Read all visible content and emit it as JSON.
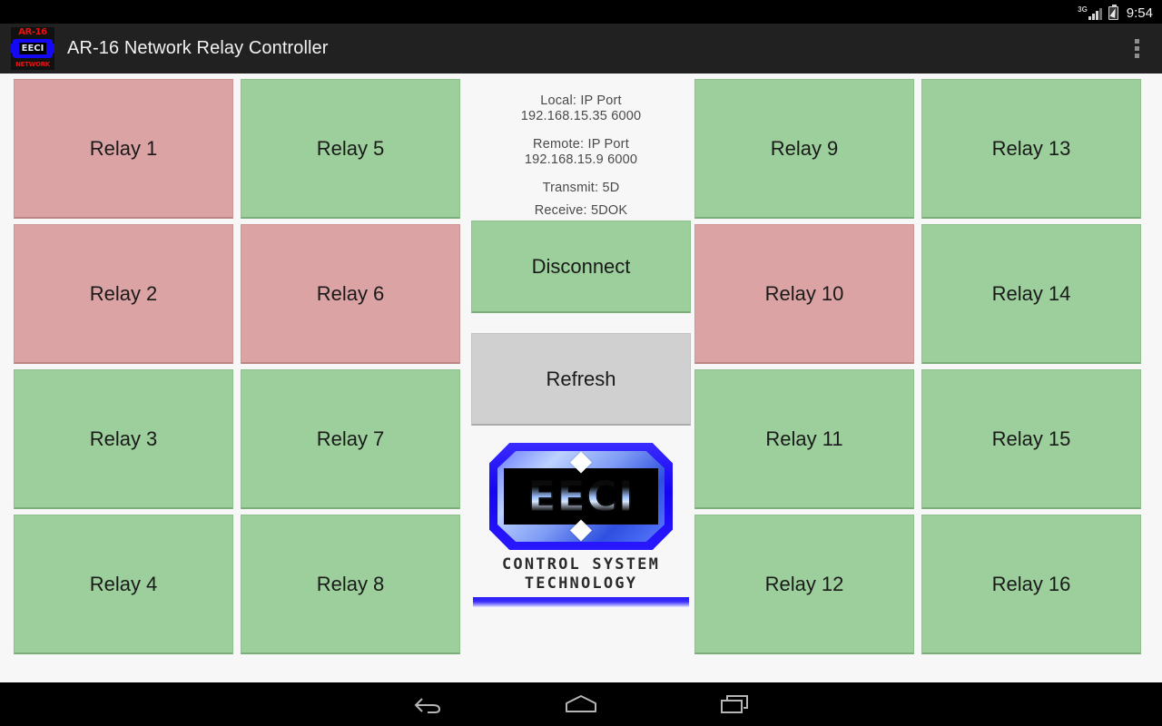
{
  "status_bar": {
    "network_label": "3G",
    "clock": "9:54",
    "battery_state": "charging"
  },
  "action_bar": {
    "app_title": "AR-16 Network Relay Controller",
    "app_icon": {
      "top_text": "AR-16",
      "badge_text": "EECI",
      "bottom_text": "NETWORK"
    },
    "overflow_label": "More options"
  },
  "connection_info": {
    "local": {
      "header": "Local:  IP   Port",
      "value": "192.168.15.35   6000",
      "ip": "192.168.15.35",
      "port": "6000"
    },
    "remote": {
      "header": "Remote:  IP   Port",
      "value": "192.168.15.9   6000",
      "ip": "192.168.15.9",
      "port": "6000"
    },
    "transmit": "Transmit:  5D",
    "receive": "Receive:  5DOK"
  },
  "actions": {
    "disconnect_label": "Disconnect",
    "refresh_label": "Refresh"
  },
  "logo": {
    "badge_text": "EECI",
    "line1": "CONTROL SYSTEM",
    "line2": "TECHNOLOGY"
  },
  "colors": {
    "relay_on": "#dba3a3",
    "relay_off": "#9ccf9b",
    "refresh": "#d0d0d0",
    "action_bar": "#212121",
    "background": "#f7f7f7"
  },
  "relays": {
    "columns": [
      [
        {
          "label": "Relay 1",
          "state": "on"
        },
        {
          "label": "Relay 2",
          "state": "on"
        },
        {
          "label": "Relay 3",
          "state": "off"
        },
        {
          "label": "Relay 4",
          "state": "off"
        }
      ],
      [
        {
          "label": "Relay 5",
          "state": "off"
        },
        {
          "label": "Relay 6",
          "state": "on"
        },
        {
          "label": "Relay 7",
          "state": "off"
        },
        {
          "label": "Relay 8",
          "state": "off"
        }
      ],
      [
        {
          "label": "Relay 9",
          "state": "off"
        },
        {
          "label": "Relay 10",
          "state": "on"
        },
        {
          "label": "Relay 11",
          "state": "off"
        },
        {
          "label": "Relay 12",
          "state": "off"
        }
      ],
      [
        {
          "label": "Relay 13",
          "state": "off"
        },
        {
          "label": "Relay 14",
          "state": "off"
        },
        {
          "label": "Relay 15",
          "state": "off"
        },
        {
          "label": "Relay 16",
          "state": "off"
        }
      ]
    ]
  },
  "nav_bar": {
    "back_label": "Back",
    "home_label": "Home",
    "recents_label": "Recent apps"
  }
}
